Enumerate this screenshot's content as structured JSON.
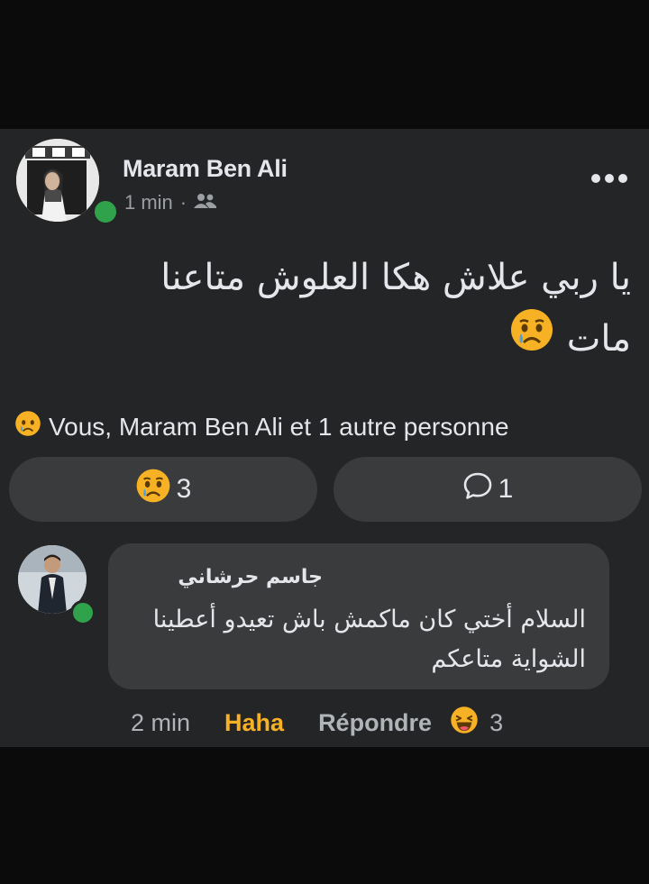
{
  "post": {
    "author": "Maram Ben Ali",
    "time": "1 min",
    "separator": "·",
    "audience_icon": "friends-icon",
    "more_icon": "more-horizontal-icon",
    "text_line1": "يا ربي علاش هكا العلوش متاعنا",
    "text_line2": "مات",
    "emoji_icon": "sad-tear-emoji"
  },
  "reactions": {
    "icon": "sad-tear-emoji",
    "summary": "Vous, Maram Ben Ali et 1 autre personne"
  },
  "buttons": {
    "reaction_count": "3",
    "comment_count": "1"
  },
  "comment": {
    "author": "جاسم حرشاني",
    "text_line1": "السلام أختي كان ماكمش باش تعيدو أعطينا",
    "text_line2": "الشواية متاعكم",
    "time": "2 min",
    "reaction_label": "Haha",
    "reply_label": "Répondre",
    "reaction_icon": "laughing-emoji",
    "reaction_count": "3"
  },
  "colors": {
    "background": "#0b0b0b",
    "card": "#242526",
    "pill": "#3a3b3c",
    "online": "#31a24c",
    "haha": "#f7b125"
  }
}
